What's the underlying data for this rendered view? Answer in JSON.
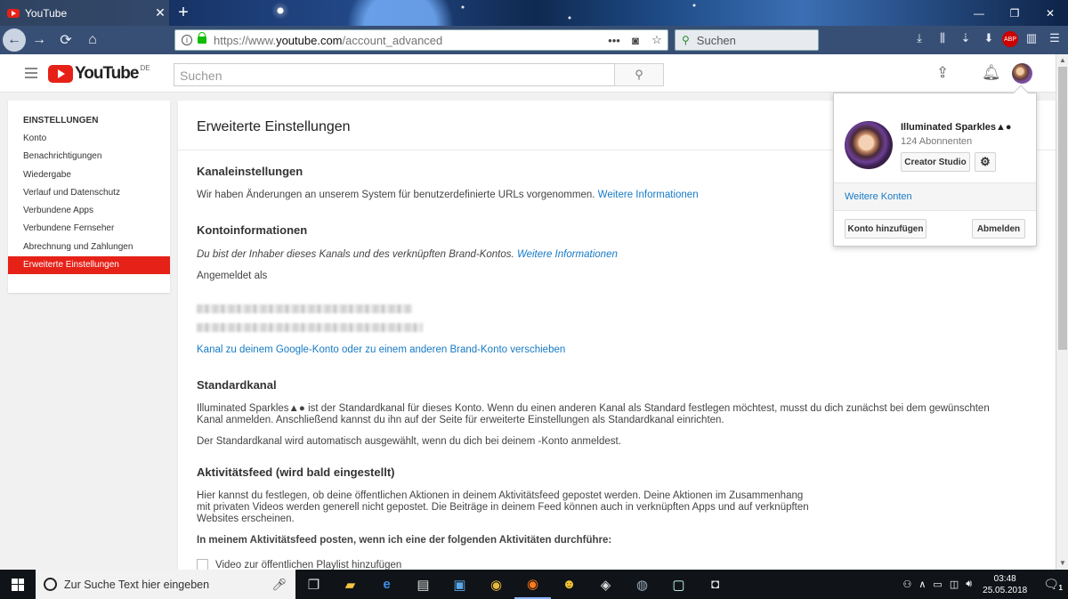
{
  "browser": {
    "tab_title": "YouTube",
    "tab_close": "✕",
    "new_tab": "+",
    "url_prefix": "https://www.",
    "url_domain": "youtube.com",
    "url_path": "/account_advanced",
    "search_placeholder": "Suchen",
    "window_controls": [
      "—",
      "❐",
      "✕"
    ],
    "toolbar_icons": [
      "download-icon",
      "library-icon",
      "sync-icon",
      "downloads-icon",
      "adblock-icon",
      "sidebar-icon",
      "menu-icon"
    ],
    "adblock_label": "ABP"
  },
  "masthead": {
    "logo_text": "YouTube",
    "country_code": "DE",
    "search_placeholder": "Suchen"
  },
  "sidebar": {
    "heading": "EINSTELLUNGEN",
    "items": [
      {
        "label": "Konto"
      },
      {
        "label": "Benachrichtigungen"
      },
      {
        "label": "Wiedergabe"
      },
      {
        "label": "Verlauf und Datenschutz"
      },
      {
        "label": "Verbundene Apps"
      },
      {
        "label": "Verbundene Fernseher"
      },
      {
        "label": "Abrechnung und Zahlungen"
      },
      {
        "label": "Erweiterte Einstellungen",
        "active": true
      }
    ]
  },
  "main": {
    "page_title": "Erweiterte Einstellungen",
    "channel_settings": {
      "heading": "Kanaleinstellungen",
      "text": "Wir haben Änderungen an unserem System für benutzerdefinierte URLs vorgenommen.",
      "link": "Weitere Informationen"
    },
    "account_info": {
      "heading": "Kontoinformationen",
      "text": "Du bist der Inhaber dieses Kanals und des verknüpften Brand-Kontos.",
      "link": "Weitere Informationen",
      "signed_in_as": "Angemeldet als",
      "move_link": "Kanal zu deinem Google-Konto oder zu einem anderen Brand-Konto verschieben"
    },
    "default_channel": {
      "heading": "Standardkanal",
      "text1": "Illuminated Sparkles▲● ist der Standardkanal für dieses Konto. Wenn du einen anderen Kanal als Standard festlegen möchtest, musst du dich zunächst bei dem gewünschten Kanal anmelden. Anschließend kannst du ihn auf der Seite für erweiterte Einstellungen als Standardkanal einrichten.",
      "text2": "Der Standardkanal wird automatisch ausgewählt, wenn du dich bei deinem -Konto anmeldest."
    },
    "activity_feed": {
      "heading": "Aktivitätsfeed (wird bald eingestellt)",
      "text": "Hier kannst du festlegen, ob deine öffentlichen Aktionen in deinem Aktivitätsfeed gepostet werden. Deine Aktionen im Zusammenhang mit privaten Videos werden generell nicht gepostet. Die Beiträge in deinem Feed können auch in verknüpften Apps und auf verknüpften Websites erscheinen.",
      "post_heading": "In meinem Aktivitätsfeed posten, wenn ich eine der folgenden Aktivitäten durchführe:",
      "option1": "Video zur öffentlichen Playlist hinzufügen"
    }
  },
  "account_menu": {
    "name": "Illuminated Sparkles▲●",
    "subscribers": "124 Abonnenten",
    "creator_studio": "Creator Studio",
    "more_accounts": "Weitere Konten",
    "add_account": "Konto hinzufügen",
    "sign_out": "Abmelden"
  },
  "taskbar": {
    "search_placeholder": "Zur Suche Text hier eingeben",
    "time": "03:48",
    "date": "25.05.2018",
    "notification_count": "1",
    "apps": [
      "task-view-icon",
      "file-explorer-icon",
      "edge-icon",
      "app-icon",
      "app-icon",
      "chrome-icon",
      "firefox-icon",
      "paint-icon",
      "maps-icon",
      "steam-icon",
      "app-icon",
      "instagram-icon"
    ]
  }
}
